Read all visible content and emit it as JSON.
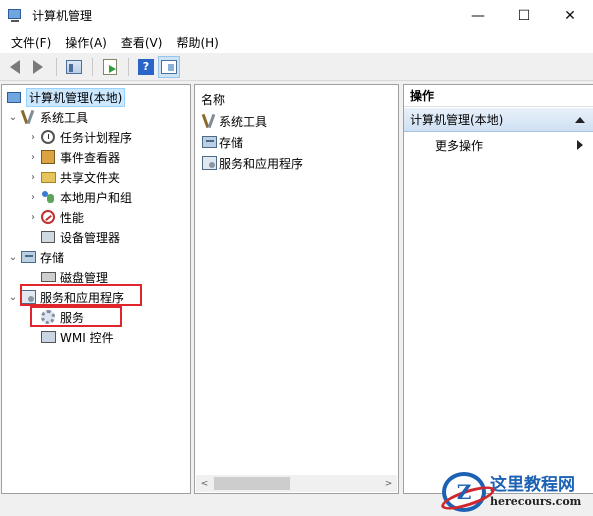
{
  "window": {
    "title": "计算机管理",
    "minimize": "—",
    "maximize": "☐",
    "close": "✕"
  },
  "menu": [
    "文件(F)",
    "操作(A)",
    "查看(V)",
    "帮助(H)"
  ],
  "toolbar": {
    "help_glyph": "?"
  },
  "tree": {
    "root": "计算机管理(本地)",
    "items": [
      {
        "label": "系统工具",
        "icon": "tools-icon",
        "expander": "v"
      },
      {
        "label": "任务计划程序",
        "icon": "clock-icon",
        "expander": ">"
      },
      {
        "label": "事件查看器",
        "icon": "event-icon",
        "expander": ">"
      },
      {
        "label": "共享文件夹",
        "icon": "folder-icon",
        "expander": ">"
      },
      {
        "label": "本地用户和组",
        "icon": "users-icon",
        "expander": ">"
      },
      {
        "label": "性能",
        "icon": "performance-icon",
        "expander": ">"
      },
      {
        "label": "设备管理器",
        "icon": "device-icon",
        "expander": ""
      },
      {
        "label": "存储",
        "icon": "storage-icon",
        "expander": "v"
      },
      {
        "label": "磁盘管理",
        "icon": "disk-icon",
        "expander": ""
      },
      {
        "label": "服务和应用程序",
        "icon": "services-apps-icon",
        "expander": "v"
      },
      {
        "label": "服务",
        "icon": "gear-icon",
        "expander": ""
      },
      {
        "label": "WMI 控件",
        "icon": "wmi-icon",
        "expander": ""
      }
    ]
  },
  "list": {
    "header": "名称",
    "rows": [
      "系统工具",
      "存储",
      "服务和应用程序"
    ],
    "scroll_left": "<",
    "scroll_right": ">"
  },
  "actions": {
    "header": "操作",
    "section": "计算机管理(本地)",
    "item": "更多操作"
  },
  "watermark": {
    "logo_letter": "Z",
    "name": "这里教程网",
    "url": "herecours.com"
  },
  "colors": {
    "selection": "#cce8ff",
    "highlight_box": "#e0262b",
    "action_header": "#cfe0f3"
  }
}
